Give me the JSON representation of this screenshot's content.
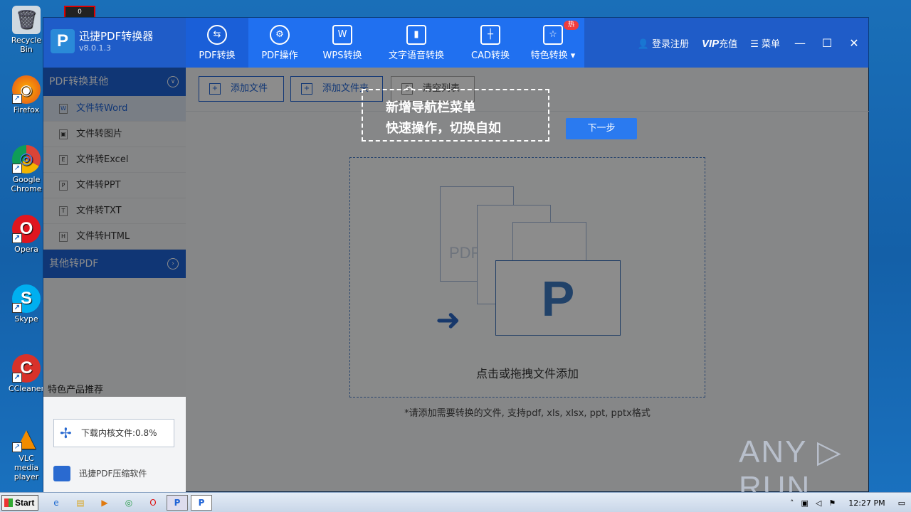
{
  "desktop": {
    "icons": [
      {
        "label": "Recycle Bin",
        "glyph": "🗑"
      },
      {
        "label": "Firefox",
        "glyph": "◉"
      },
      {
        "label": "Google Chrome",
        "glyph": "◎"
      },
      {
        "label": "Opera",
        "glyph": "O"
      },
      {
        "label": "Skype",
        "glyph": "S"
      },
      {
        "label": "CCleaner",
        "glyph": "C"
      },
      {
        "label": "VLC media player",
        "glyph": "▲"
      }
    ],
    "topbox": "0"
  },
  "app": {
    "name": "迅捷PDF转换器",
    "version": "v8.0.1.3",
    "logo_letter": "P",
    "nav_tabs": [
      {
        "label": "PDF转换",
        "icon": "⇆"
      },
      {
        "label": "PDF操作",
        "icon": "⚙"
      },
      {
        "label": "WPS转换",
        "icon": "W"
      },
      {
        "label": "文字语音转换",
        "icon": "▮"
      },
      {
        "label": "CAD转换",
        "icon": "┼"
      },
      {
        "label": "特色转换 ▾",
        "icon": "☆",
        "badge": "热"
      }
    ],
    "login": "登录注册",
    "vip": "VIP",
    "vip_suffix": "充值",
    "menu": "菜单"
  },
  "sidebar": {
    "section1": "PDF转换其他",
    "items": [
      "文件转Word",
      "文件转图片",
      "文件转Excel",
      "文件转PPT",
      "文件转TXT",
      "文件转HTML"
    ],
    "item_icons": [
      "W",
      "▣",
      "E",
      "P",
      "T",
      "H"
    ],
    "section2": "其他转PDF",
    "promo_title": "特色产品推荐",
    "download_text": "下载内核文件:0.8%",
    "compress_label": "迅捷PDF压缩软件"
  },
  "toolbar": {
    "add_file": "添加文件",
    "add_folder": "添加文件夹",
    "clear": "清空列表"
  },
  "dropzone": {
    "label": "点击或拖拽文件添加",
    "pdf_text": "PDF",
    "folder_letter": "P",
    "hint": "*请添加需要转换的文件, 支持pdf, xls, xlsx, ppt, pptx格式"
  },
  "guide": {
    "line1": "新增导航栏菜单",
    "line2": "快速操作，切换自如",
    "next": "下一步"
  },
  "taskbar": {
    "start": "Start",
    "time": "12:27 PM"
  },
  "watermark": "ANY ▷ RUN"
}
